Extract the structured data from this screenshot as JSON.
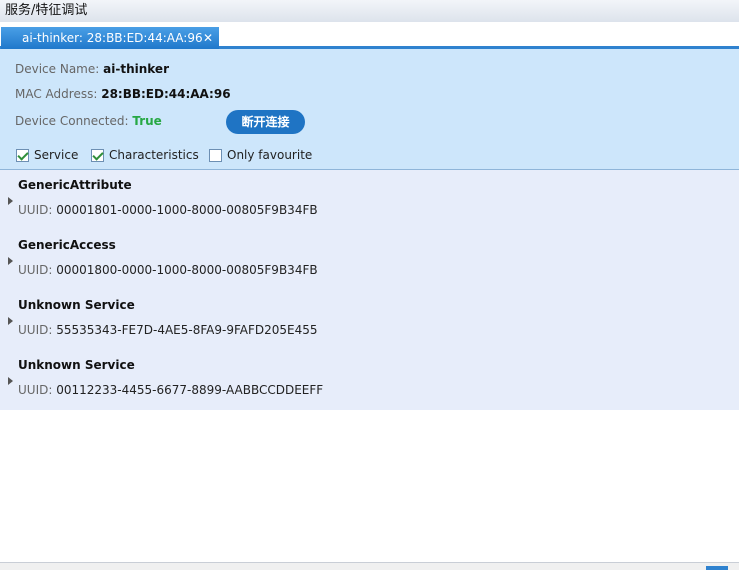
{
  "window": {
    "title": "服务/特征调试"
  },
  "tab": {
    "label": "ai-thinker: 28:BB:ED:44:AA:96",
    "close_glyph": "✕"
  },
  "device": {
    "name_label": "Device Name:",
    "name_value": "ai-thinker",
    "mac_label": "MAC Address:",
    "mac_value": "28:BB:ED:44:AA:96",
    "connected_label": "Device Connected:",
    "connected_value": "True",
    "disconnect_button": "断开连接"
  },
  "filters": [
    {
      "label": "Service",
      "checked": true
    },
    {
      "label": "Characteristics",
      "checked": true
    },
    {
      "label": "Only favourite",
      "checked": false
    }
  ],
  "services": [
    {
      "name": "GenericAttribute",
      "uuid_label": "UUID:",
      "uuid": "00001801-0000-1000-8000-00805F9B34FB"
    },
    {
      "name": "GenericAccess",
      "uuid_label": "UUID:",
      "uuid": "00001800-0000-1000-8000-00805F9B34FB"
    },
    {
      "name": "Unknown Service",
      "uuid_label": "UUID:",
      "uuid": "55535343-FE7D-4AE5-8FA9-9FAFD205E455"
    },
    {
      "name": "Unknown Service",
      "uuid_label": "UUID:",
      "uuid": "00112233-4455-6677-8899-AABBCCDDEEFF"
    }
  ],
  "colors": {
    "accent": "#1f74c4",
    "connected": "#27a844",
    "panel": "#cde6fb",
    "list": "#e7edfa"
  }
}
